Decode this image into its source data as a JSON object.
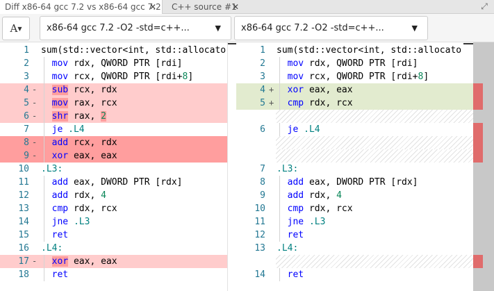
{
  "tabs": [
    {
      "label": "Diff x86-64 gcc 7.2 vs x86-64 gcc 7.2",
      "close": "✕",
      "active": true
    },
    {
      "label": "C++ source #1",
      "close": "✕",
      "active": false
    }
  ],
  "maximize_glyph": "⤢",
  "toolbar": {
    "font_button": "A",
    "caret": "▼",
    "left_compiler": "x86-64 gcc 7.2 -O2 -std=c++...",
    "right_compiler": "x86-64 gcc 7.2 -O2 -std=c++...",
    "dropdown_arrow": "▼"
  },
  "left_lines": [
    {
      "n": "1",
      "m": "",
      "t": "sum(std::vector<int, std::allocato",
      "k": "fn",
      "s": ""
    },
    {
      "n": "2",
      "m": "",
      "t": "  mov rdx, QWORD PTR [rdi]",
      "k": "ins",
      "s": ""
    },
    {
      "n": "3",
      "m": "",
      "t": "  mov rcx, QWORD PTR [rdi+8]",
      "k": "ins",
      "s": ""
    },
    {
      "n": "4",
      "m": "-",
      "t": "  sub rcx, rdx",
      "k": "ins",
      "s": "del"
    },
    {
      "n": "5",
      "m": "-",
      "t": "  mov rax, rcx",
      "k": "ins",
      "s": "del"
    },
    {
      "n": "6",
      "m": "-",
      "t": "  shr rax, 2",
      "k": "ins",
      "s": "del"
    },
    {
      "n": "7",
      "m": "",
      "t": "  je .L4",
      "k": "ins",
      "s": ""
    },
    {
      "n": "8",
      "m": "-",
      "t": "  add rcx, rdx",
      "k": "ins",
      "s": "del2"
    },
    {
      "n": "9",
      "m": "-",
      "t": "  xor eax, eax",
      "k": "ins",
      "s": "del2"
    },
    {
      "n": "10",
      "m": "",
      "t": ".L3:",
      "k": "lbl",
      "s": ""
    },
    {
      "n": "11",
      "m": "",
      "t": "  add eax, DWORD PTR [rdx]",
      "k": "ins",
      "s": ""
    },
    {
      "n": "12",
      "m": "",
      "t": "  add rdx, 4",
      "k": "ins",
      "s": ""
    },
    {
      "n": "13",
      "m": "",
      "t": "  cmp rdx, rcx",
      "k": "ins",
      "s": ""
    },
    {
      "n": "14",
      "m": "",
      "t": "  jne .L3",
      "k": "ins",
      "s": ""
    },
    {
      "n": "15",
      "m": "",
      "t": "  ret",
      "k": "ins",
      "s": ""
    },
    {
      "n": "16",
      "m": "",
      "t": ".L4:",
      "k": "lbl",
      "s": ""
    },
    {
      "n": "17",
      "m": "-",
      "t": "  xor eax, eax",
      "k": "ins",
      "s": "del"
    },
    {
      "n": "18",
      "m": "",
      "t": "  ret",
      "k": "ins",
      "s": ""
    }
  ],
  "right_lines": [
    {
      "n": "1",
      "m": "",
      "t": "sum(std::vector<int, std::allocato",
      "k": "fn",
      "s": ""
    },
    {
      "n": "2",
      "m": "",
      "t": "  mov rdx, QWORD PTR [rdi]",
      "k": "ins",
      "s": ""
    },
    {
      "n": "3",
      "m": "",
      "t": "  mov rcx, QWORD PTR [rdi+8]",
      "k": "ins",
      "s": ""
    },
    {
      "n": "4",
      "m": "+",
      "t": "  xor eax, eax",
      "k": "ins",
      "s": "ins"
    },
    {
      "n": "5",
      "m": "+",
      "t": "  cmp rdx, rcx",
      "k": "ins",
      "s": "ins"
    },
    {
      "n": "",
      "m": "",
      "t": "",
      "k": "",
      "s": "hatch"
    },
    {
      "n": "6",
      "m": "",
      "t": "  je .L4",
      "k": "ins",
      "s": ""
    },
    {
      "n": "",
      "m": "",
      "t": "",
      "k": "",
      "s": "hatch"
    },
    {
      "n": "",
      "m": "",
      "t": "",
      "k": "",
      "s": "hatch"
    },
    {
      "n": "7",
      "m": "",
      "t": ".L3:",
      "k": "lbl",
      "s": ""
    },
    {
      "n": "8",
      "m": "",
      "t": "  add eax, DWORD PTR [rdx]",
      "k": "ins",
      "s": ""
    },
    {
      "n": "9",
      "m": "",
      "t": "  add rdx, 4",
      "k": "ins",
      "s": ""
    },
    {
      "n": "10",
      "m": "",
      "t": "  cmp rdx, rcx",
      "k": "ins",
      "s": ""
    },
    {
      "n": "11",
      "m": "",
      "t": "  jne .L3",
      "k": "ins",
      "s": ""
    },
    {
      "n": "12",
      "m": "",
      "t": "  ret",
      "k": "ins",
      "s": ""
    },
    {
      "n": "13",
      "m": "",
      "t": ".L4:",
      "k": "lbl",
      "s": ""
    },
    {
      "n": "",
      "m": "",
      "t": "",
      "k": "",
      "s": "hatch"
    },
    {
      "n": "14",
      "m": "",
      "t": "  ret",
      "k": "ins",
      "s": ""
    }
  ],
  "colors": {
    "deleted": "#ff9e9e",
    "deleted_light": "#ffcccc",
    "inserted": "#c8d8a6",
    "overview_mark": "#e06c6c"
  }
}
